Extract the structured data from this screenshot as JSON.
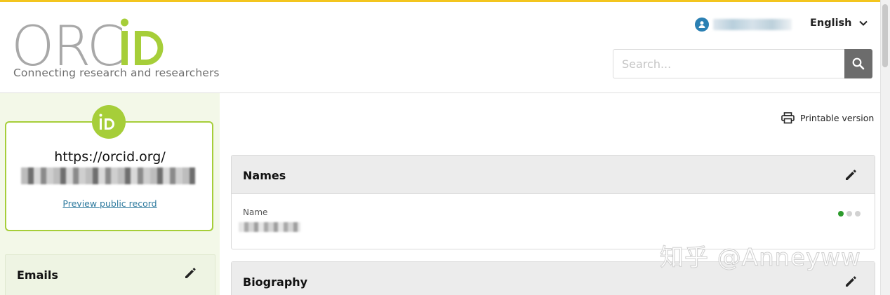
{
  "header": {
    "logo_text": "ORCiD",
    "tagline": "Connecting research and researchers",
    "language": "English",
    "search": {
      "placeholder": "Search..."
    }
  },
  "sidebar": {
    "orcid_prefix": "https://orcid.org/",
    "preview_link": "Preview public record",
    "emails_title": "Emails"
  },
  "main": {
    "printable_label": "Printable version",
    "names_panel": {
      "title": "Names",
      "field_label": "Name",
      "visibility_levels": [
        "everyone",
        "trusted",
        "only-me"
      ],
      "visibility_selected": "everyone"
    },
    "biography_panel": {
      "title": "Biography"
    }
  },
  "watermark": "知乎 @Anneyww",
  "colors": {
    "brand_green": "#a6ce39",
    "accent_yellow": "#f3c51e",
    "user_blue": "#2b80b3",
    "link_blue": "#2e7a9e",
    "visibility_green": "#2d9b2d"
  }
}
